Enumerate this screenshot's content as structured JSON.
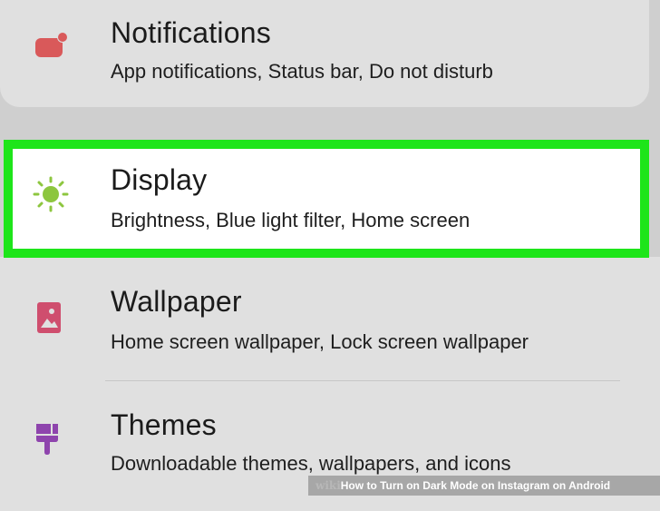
{
  "settings": {
    "items": [
      {
        "title": "Notifications",
        "subtitle": "App notifications, Status bar, Do not disturb",
        "icon": "notification-icon",
        "icon_color": "#d9595a"
      },
      {
        "title": "Display",
        "subtitle": "Brightness, Blue light filter, Home screen",
        "icon": "brightness-icon",
        "icon_color": "#8dc63f"
      },
      {
        "title": "Wallpaper",
        "subtitle": "Home screen wallpaper, Lock screen wallpaper",
        "icon": "wallpaper-icon",
        "icon_color": "#cf4e6e"
      },
      {
        "title": "Themes",
        "subtitle": "Downloadable themes, wallpapers, and icons",
        "icon": "themes-icon",
        "icon_color": "#8e44ad"
      }
    ]
  },
  "highlight_color": "#1ee51a",
  "watermark": {
    "brand": "wiki",
    "how": "How",
    "text": " to Turn on Dark Mode on Instagram on Android"
  }
}
